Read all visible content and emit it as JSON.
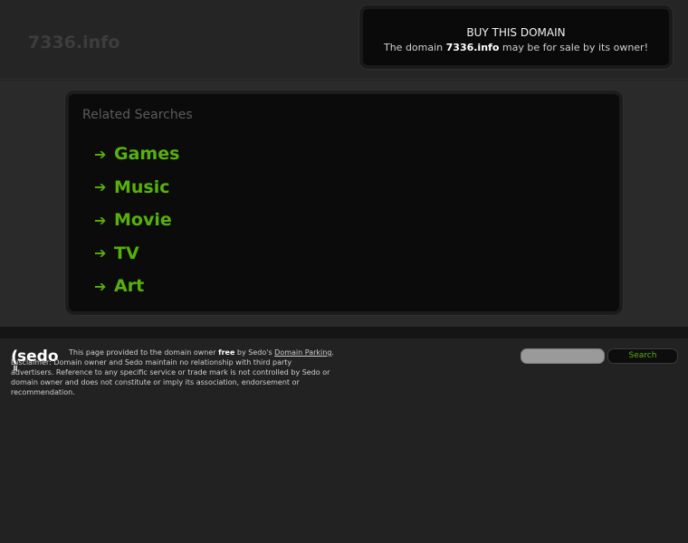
{
  "header": {
    "site_title": "7336.info"
  },
  "buy_box": {
    "title": "BUY THIS DOMAIN",
    "text_before": "The domain ",
    "domain": "7336.info",
    "text_after": " may be for sale by its owner!"
  },
  "related": {
    "heading": "Related Searches",
    "arrow_glyph": "➔",
    "items": [
      {
        "label": "Games"
      },
      {
        "label": "Music"
      },
      {
        "label": "Movie"
      },
      {
        "label": "TV"
      },
      {
        "label": "Art"
      }
    ]
  },
  "footer": {
    "logo": {
      "paren": "(",
      "word": "sedo",
      "dots": "⠿"
    },
    "disclaimer": {
      "part1": "This page provided to the domain owner ",
      "free": "free",
      "part2": " by Sedo's ",
      "link": "Domain Parking",
      "part3": ". Disclaimer: Domain owner and Sedo maintain no relationship with third party advertisers. Reference to any specific service or trade mark is not controlled by Sedo or domain owner and does not constitute or imply its association, endorsement or recommendation."
    },
    "search": {
      "placeholder": "",
      "value": "",
      "button_label": "Search"
    }
  },
  "colors": {
    "background": "#222222",
    "panel": "#0b0b0b",
    "accent_green": "#57b10a",
    "muted_text": "#5b5b5b"
  }
}
